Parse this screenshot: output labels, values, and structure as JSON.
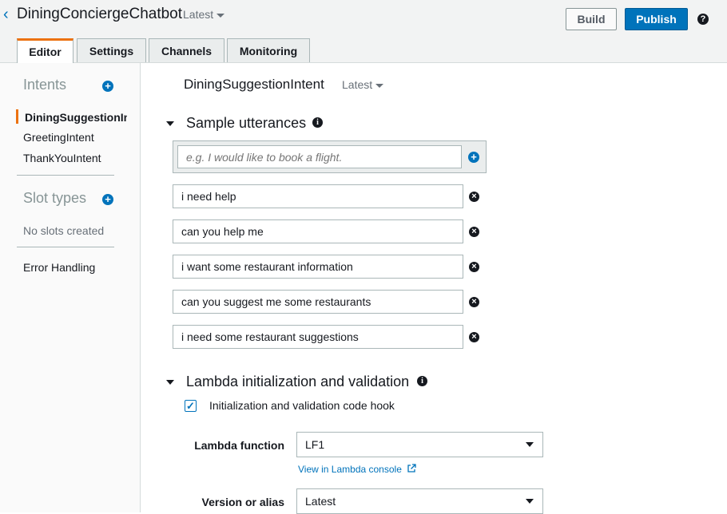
{
  "header": {
    "bot_name": "DiningConciergeChatbot",
    "version": "Latest",
    "build_label": "Build",
    "publish_label": "Publish",
    "help_symbol": "?"
  },
  "tabs": [
    {
      "label": "Editor"
    },
    {
      "label": "Settings"
    },
    {
      "label": "Channels"
    },
    {
      "label": "Monitoring"
    }
  ],
  "sidebar": {
    "intents_heading": "Intents",
    "intents": [
      {
        "label": "DiningSuggestionIntent"
      },
      {
        "label": "GreetingIntent"
      },
      {
        "label": "ThankYouIntent"
      }
    ],
    "slot_types_heading": "Slot types",
    "no_slots_text": "No slots created",
    "error_handling": "Error Handling"
  },
  "main": {
    "intent_title": "DiningSuggestionIntent",
    "intent_version": "Latest",
    "utterances_heading": "Sample utterances",
    "utterance_placeholder": "e.g. I would like to book a flight.",
    "utterances": [
      "i need help",
      "can you help me",
      "i want some restaurant information",
      "can you suggest me some restaurants",
      "i need some restaurant suggestions"
    ],
    "lambda_heading": "Lambda initialization and validation",
    "hook_label": "Initialization and validation code hook",
    "hook_checked": true,
    "lambda_function_label": "Lambda function",
    "lambda_function_value": "LF1",
    "lambda_link": "View in Lambda console",
    "version_label": "Version or alias",
    "version_value": "Latest"
  },
  "colors": {
    "accent": "#0073bb",
    "active_tab": "#ec7211"
  }
}
